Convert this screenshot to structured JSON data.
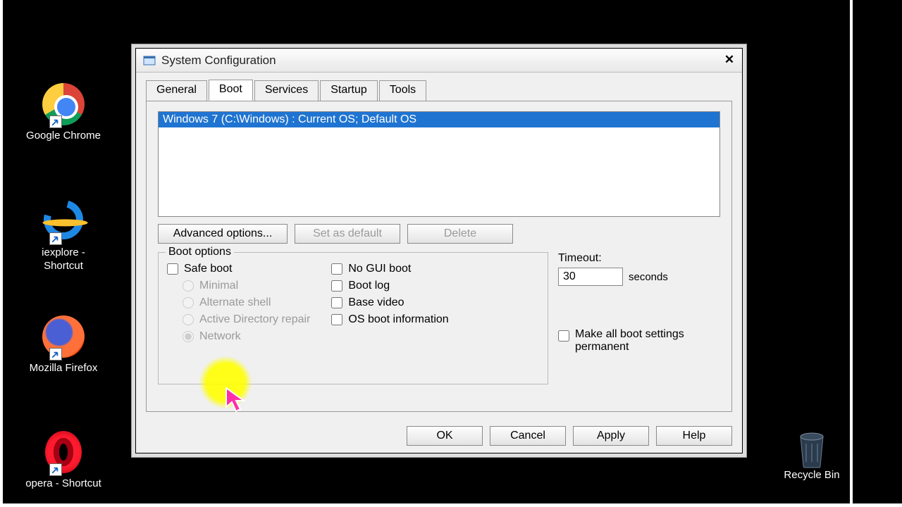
{
  "desktop": {
    "icons": [
      {
        "label": "Google Chrome"
      },
      {
        "label": "iexplore - Shortcut"
      },
      {
        "label": "Mozilla Firefox"
      },
      {
        "label": "opera - Shortcut"
      },
      {
        "label": "Recycle Bin"
      }
    ]
  },
  "dialog": {
    "title": "System Configuration",
    "tabs": [
      "General",
      "Boot",
      "Services",
      "Startup",
      "Tools"
    ],
    "active_tab": "Boot",
    "os_entry": "Windows 7 (C:\\Windows) : Current OS; Default OS",
    "buttons": {
      "advanced": "Advanced options...",
      "set_default": "Set as default",
      "delete": "Delete"
    },
    "boot_options": {
      "legend": "Boot options",
      "safe_boot": "Safe boot",
      "minimal": "Minimal",
      "alternate_shell": "Alternate shell",
      "ad_repair": "Active Directory repair",
      "network": "Network",
      "no_gui": "No GUI boot",
      "boot_log": "Boot log",
      "base_video": "Base video",
      "os_boot_info": "OS boot information"
    },
    "timeout": {
      "label": "Timeout:",
      "value": "30",
      "unit": "seconds"
    },
    "permanent": "Make all boot settings permanent",
    "footer": {
      "ok": "OK",
      "cancel": "Cancel",
      "apply": "Apply",
      "help": "Help"
    }
  }
}
